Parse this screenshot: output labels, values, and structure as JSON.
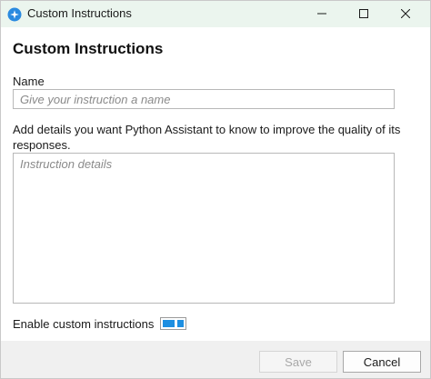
{
  "window": {
    "title": "Custom Instructions",
    "icon": "assistant-sparkle-icon",
    "controls": {
      "minimize": "minimize-icon",
      "maximize": "maximize-icon",
      "close": "close-icon"
    }
  },
  "form": {
    "heading": "Custom Instructions",
    "name_label": "Name",
    "name_value": "",
    "name_placeholder": "Give your instruction a name",
    "details_label": "Add details you want Python Assistant to know to improve the quality of its responses.",
    "details_value": "",
    "details_placeholder": "Instruction details",
    "enable_label": "Enable custom instructions",
    "enable_on": true
  },
  "footer": {
    "save_label": "Save",
    "save_enabled": false,
    "cancel_label": "Cancel"
  },
  "colors": {
    "titlebar": "#ebf5ee",
    "accent": "#1e8fe1",
    "footer": "#f0f0f0"
  }
}
